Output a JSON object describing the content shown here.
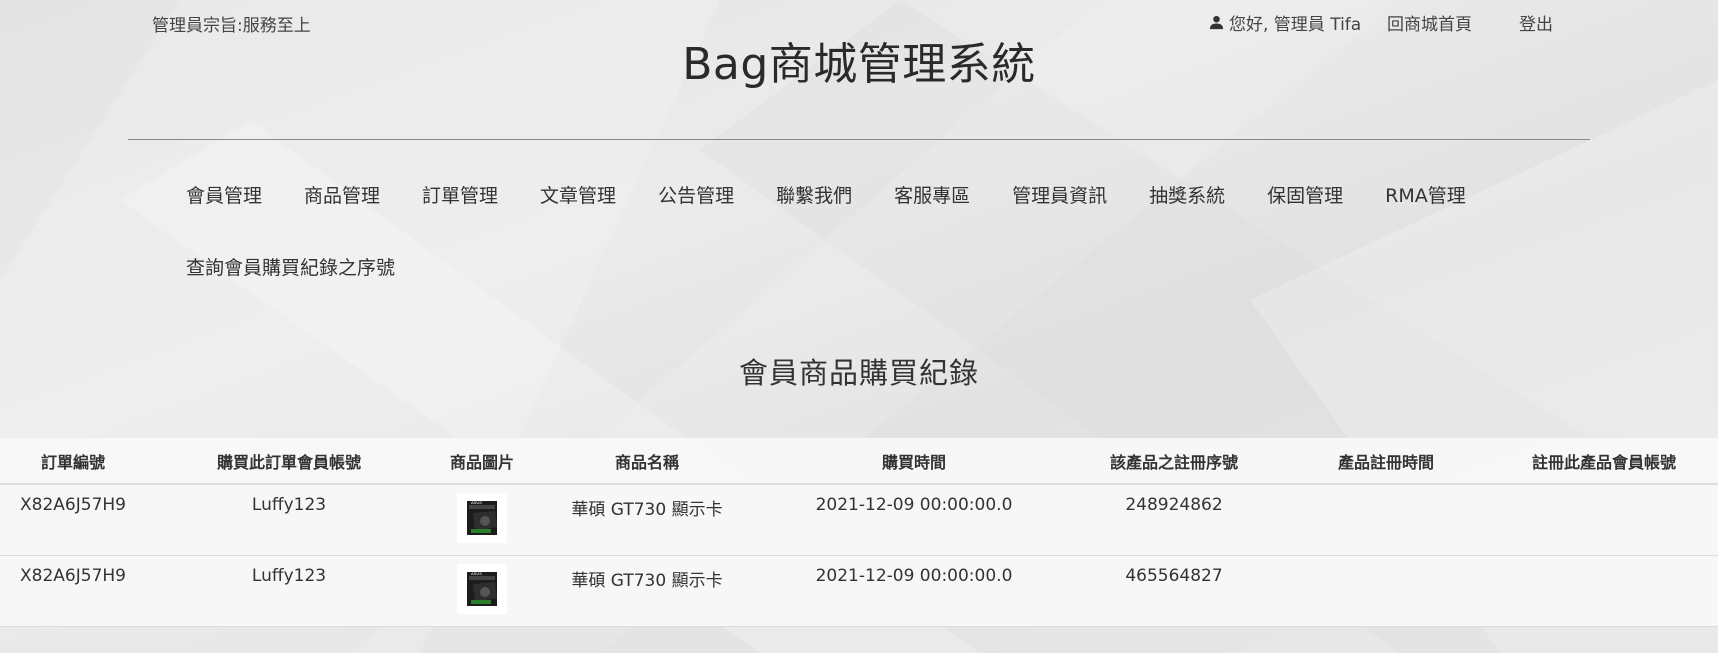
{
  "header": {
    "motto": "管理員宗旨:服務至上",
    "greeting": "您好, 管理員 Tifa",
    "home_link": "回商城首頁",
    "logout": "登出",
    "site_title": "Bag商城管理系統"
  },
  "nav": {
    "items": [
      "會員管理",
      "商品管理",
      "訂單管理",
      "文章管理",
      "公告管理",
      "聯繫我們",
      "客服專區",
      "管理員資訊",
      "抽獎系統",
      "保固管理",
      "RMA管理"
    ],
    "item_row2": "查詢會員購買紀錄之序號"
  },
  "main": {
    "section_title": "會員商品購買紀錄",
    "columns": [
      "訂單編號",
      "購買此訂單會員帳號",
      "商品圖片",
      "商品名稱",
      "購買時間",
      "該產品之註冊序號",
      "產品註冊時間",
      "註冊此產品會員帳號"
    ],
    "rows": [
      {
        "order_id": "X82A6J57H9",
        "member": "Luffy123",
        "image_icon": "graphics-card-thumbnail",
        "product": "華碩 GT730 顯示卡",
        "time": "2021-12-09 00:00:00.0",
        "serial": "248924862",
        "reg_time": "",
        "reg_member": ""
      },
      {
        "order_id": "X82A6J57H9",
        "member": "Luffy123",
        "image_icon": "graphics-card-thumbnail",
        "product": "華碩 GT730 顯示卡",
        "time": "2021-12-09 00:00:00.0",
        "serial": "465564827",
        "reg_time": "",
        "reg_member": ""
      }
    ]
  },
  "colors": {
    "background": "#e6e6e6",
    "text": "#333333",
    "table_bg": "#f8f8f8"
  }
}
